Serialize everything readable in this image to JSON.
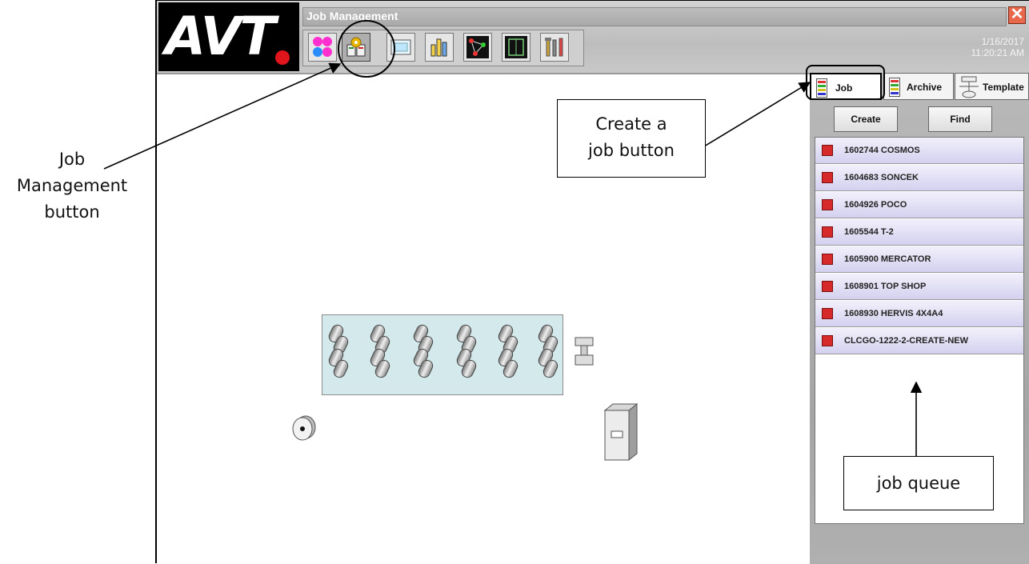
{
  "app": {
    "logo": "AVT",
    "title": "Job Management",
    "date": "1/16/2017",
    "time": "11:20:21 AM"
  },
  "toolbar": {
    "icons": [
      "color-circles-icon",
      "job-management-icon",
      "inspection-screen-icon",
      "bar-chart-icon",
      "network-graph-icon",
      "layout-frame-icon",
      "tools-icon"
    ]
  },
  "panel": {
    "tabs": [
      {
        "label": "Job",
        "icon": "job-doc-icon"
      },
      {
        "label": "Archive",
        "icon": "archive-doc-icon"
      },
      {
        "label": "Template",
        "icon": "template-icon"
      }
    ],
    "create_label": "Create",
    "find_label": "Find",
    "queue": [
      "1602744 COSMOS",
      "1604683 SONCEK",
      "1604926 POCO",
      "1605544 T-2",
      "1605900 MERCATOR",
      "1608901 TOP SHOP",
      "1608930 HERVIS 4X4A4",
      "CLCGO-1222-2-CREATE-NEW"
    ]
  },
  "annotations": {
    "job_management_lines": [
      "Job",
      "Management",
      "button"
    ],
    "create_job_lines": [
      "Create a",
      "job button"
    ],
    "job_queue": "job queue"
  },
  "colors": {
    "accent_red": "#d62a2a",
    "queue_item_bg": "#d3d1ef",
    "machine_bg": "#d3e9ec"
  }
}
